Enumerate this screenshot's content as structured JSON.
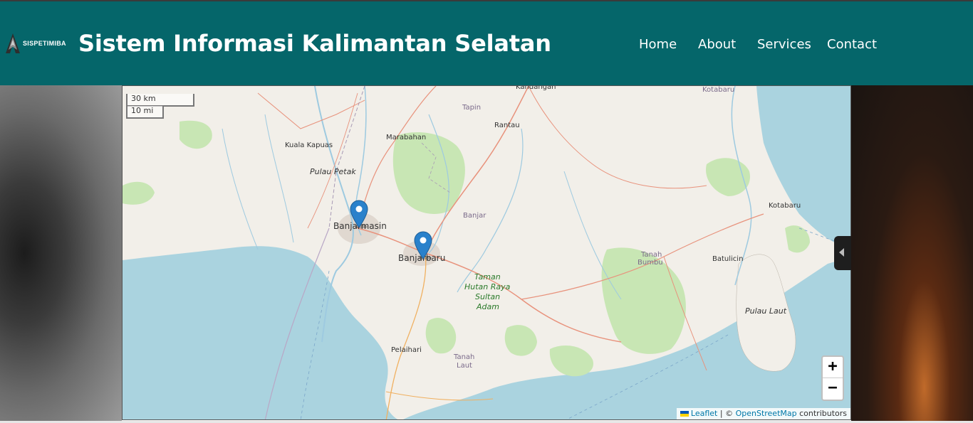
{
  "header": {
    "logo_text": "SISPETIMIBA",
    "title": "Sistem Informasi Kalimantan Selatan",
    "nav": [
      {
        "label": "Home"
      },
      {
        "label": "About"
      },
      {
        "label": "Services"
      },
      {
        "label": "Contact"
      }
    ]
  },
  "map": {
    "scale_metric": "30 km",
    "scale_imperial": "10 mi",
    "zoom_in": "+",
    "zoom_out": "−",
    "attribution": {
      "leaflet": "Leaflet",
      "separator": " | © ",
      "osm": "OpenStreetMap",
      "contributors": " contributors"
    },
    "places": {
      "kandangan": "Kandangan",
      "kotabaru_top": "Kotabaru",
      "tapin": "Tapin",
      "rantau": "Rantau",
      "marabahan": "Marabahan",
      "kuala_kapuas": "Kuala Kapuas",
      "pulau_petak": "Pulau Petak",
      "banjar": "Banjar",
      "kotabaru": "Kotabaru",
      "banjarmasin": "Banjarmasin",
      "banjarbaru": "Banjarbaru",
      "tanah_bumbu_1": "Tanah",
      "tanah_bumbu_2": "Bumbu",
      "batulicin": "Batulicin",
      "taman_1": "Taman",
      "taman_2": "Hutan Raya",
      "taman_3": "Sultan",
      "taman_4": "Adam",
      "pulau_laut": "Pulau Laut",
      "pelaihari": "Pelaihari",
      "tanah_laut_1": "Tanah",
      "tanah_laut_2": "Laut"
    },
    "markers": [
      "Banjarmasin",
      "Banjarbaru"
    ],
    "colors": {
      "water": "#aad3df",
      "land": "#f2efe9",
      "forest": "#c8e6b4",
      "road": "#e8927c",
      "river": "#9ecae0",
      "marker": "#2a81cb"
    }
  }
}
